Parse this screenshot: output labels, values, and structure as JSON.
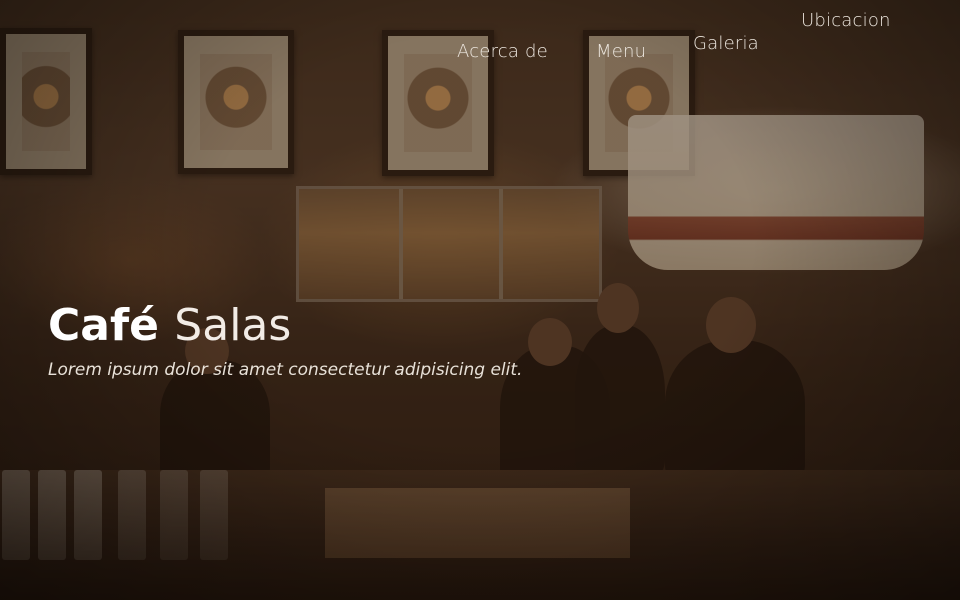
{
  "nav": {
    "items": [
      {
        "label": "Acerca de"
      },
      {
        "label": "Menu"
      },
      {
        "label": "Galeria"
      },
      {
        "label": "Ubicacion"
      }
    ]
  },
  "hero": {
    "brand_strong": "Café",
    "brand_light": "Salas",
    "tagline": "Lorem ipsum dolor sit amet consectetur adipisicing elit."
  },
  "colors": {
    "background": "#2a1a10",
    "text": "#ffffff",
    "nav_text": "#ece6de"
  }
}
